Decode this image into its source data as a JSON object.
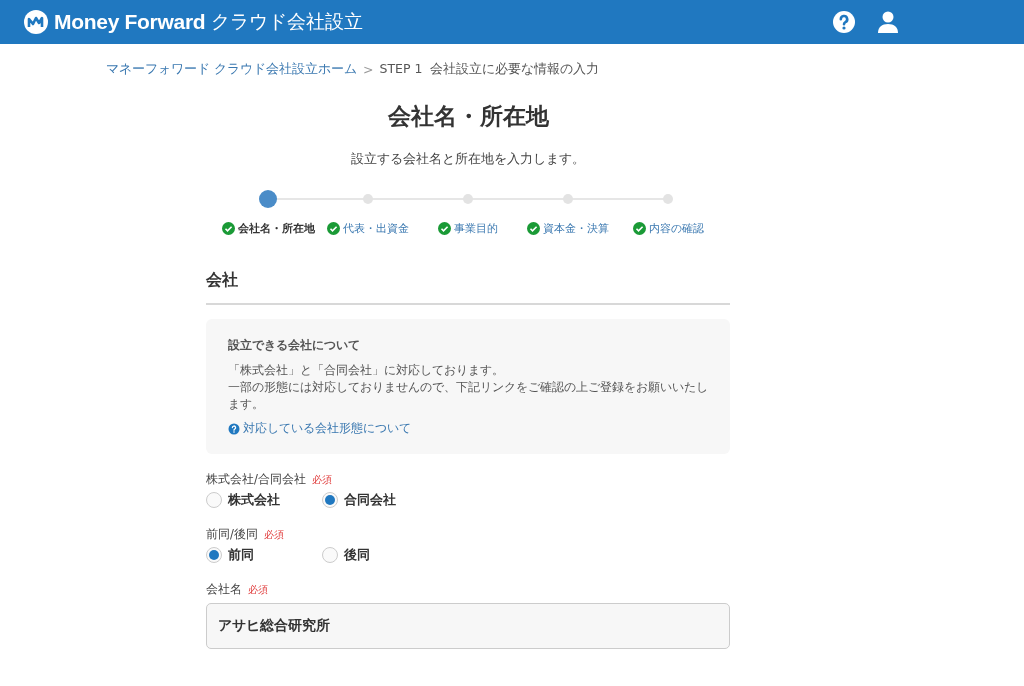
{
  "header": {
    "logo": "Money Forward",
    "product": "クラウド会社設立"
  },
  "breadcrumb": {
    "items": [
      {
        "label": "マネーフォワード クラウド会社設立ホーム",
        "kind": "link"
      },
      {
        "label": "STEP 1  会社設立に必要な情報の入力",
        "kind": "current"
      }
    ],
    "separator": ">"
  },
  "page": {
    "title": "会社名・所在地",
    "subtitle": "設立する会社名と所在地を入力します。"
  },
  "steps": [
    {
      "label": "会社名・所在地",
      "done": true,
      "selected": true
    },
    {
      "label": "代表・出資金",
      "done": true,
      "selected": false
    },
    {
      "label": "事業目的",
      "done": true,
      "selected": false
    },
    {
      "label": "資本金・決算",
      "done": true,
      "selected": false
    },
    {
      "label": "内容の確認",
      "done": true,
      "selected": false
    }
  ],
  "section": {
    "title": "会社"
  },
  "info": {
    "title": "設立できる会社について",
    "lines": [
      "「株式会社」と「合同会社」に対応しております。",
      "一部の形態には対応しておりませんので、下記リンクをご確認の上ご登録をお願いいたします。"
    ],
    "link": "対応している会社形態について"
  },
  "fields": [
    {
      "kind": "radio",
      "label": "株式会社/合同会社",
      "required": "必須",
      "options": [
        {
          "label": "株式会社",
          "selected": false
        },
        {
          "label": "合同会社",
          "selected": true
        }
      ]
    },
    {
      "kind": "radio",
      "label": "前同/後同",
      "required": "必須",
      "options": [
        {
          "label": "前同",
          "selected": true
        },
        {
          "label": "後同",
          "selected": false
        }
      ]
    },
    {
      "kind": "text",
      "label": "会社名",
      "required": "必須",
      "value": "アサヒ総合研究所"
    }
  ]
}
